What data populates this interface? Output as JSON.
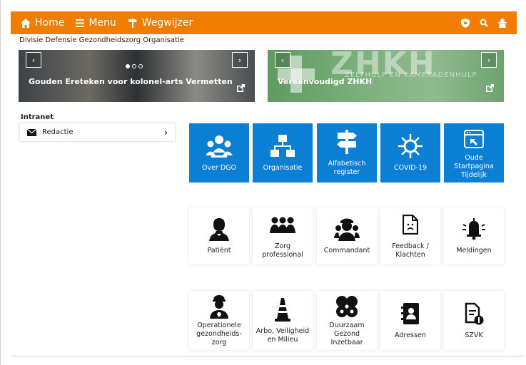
{
  "nav": {
    "home": "Home",
    "menu": "Menu",
    "wegwijzer": "Wegwijzer"
  },
  "org_name": "Divisie Defensie Gezondheidszorg Organisatie",
  "banners": [
    {
      "title": "Gouden Ereteken voor kolonel-arts Vermetten"
    },
    {
      "title": "Vereenvoudigd ZHKH",
      "image_text": "ZHKH",
      "image_subtext": "ZELFHULP EN KAMERADENHULP"
    }
  ],
  "carousel": {
    "prev": "‹",
    "next": "›"
  },
  "intranet": {
    "label": "Intranet",
    "items": [
      {
        "label": "Redactie",
        "chevron": "›"
      }
    ]
  },
  "tiles_row1": [
    {
      "label": "Over DGO",
      "icon": "doctors-group-icon"
    },
    {
      "label": "Organisatie",
      "icon": "org-chart-icon"
    },
    {
      "label": "Alfabetisch register",
      "icon": "signpost-icon"
    },
    {
      "label": "COVID-19",
      "icon": "virus-icon"
    },
    {
      "label": "Oude Startpagina Tijdelijk",
      "icon": "browser-window-icon"
    }
  ],
  "tiles_row2": [
    {
      "label": "Patiënt",
      "icon": "patient-icon"
    },
    {
      "label": "Zorg professional",
      "icon": "care-team-icon"
    },
    {
      "label": "Commandant",
      "icon": "commander-icon"
    },
    {
      "label": "Feedback / Klachten",
      "icon": "feedback-document-icon"
    },
    {
      "label": "Meldingen",
      "icon": "alarm-bell-icon"
    }
  ],
  "tiles_row3": [
    {
      "label": "Operationele gezondheids-zorg",
      "icon": "soldier-icon"
    },
    {
      "label": "Arbo, Veiligheid en Milieu",
      "icon": "traffic-cone-icon"
    },
    {
      "label": "Duurzaam Gezond Inzetbaar",
      "icon": "clover-icon"
    },
    {
      "label": "Adressen",
      "icon": "address-book-icon"
    },
    {
      "label": "SZVK",
      "icon": "document-money-icon"
    }
  ],
  "colors": {
    "topbar": "#f07c00",
    "tile_blue": "#0b7fd3"
  }
}
